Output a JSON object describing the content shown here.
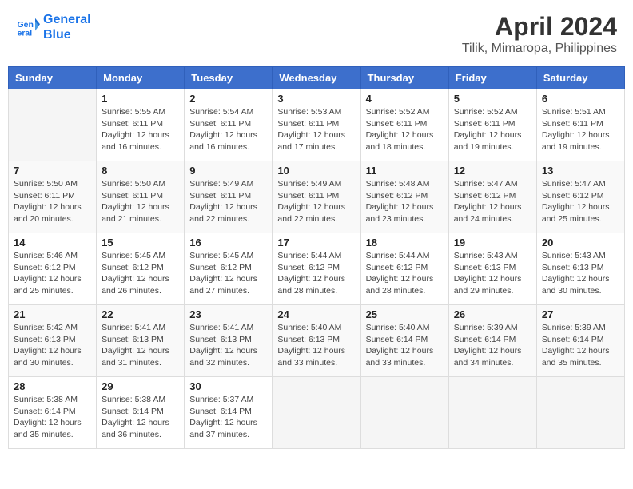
{
  "header": {
    "logo_line1": "General",
    "logo_line2": "Blue",
    "title": "April 2024",
    "subtitle": "Tilik, Mimaropa, Philippines"
  },
  "calendar": {
    "days_of_week": [
      "Sunday",
      "Monday",
      "Tuesday",
      "Wednesday",
      "Thursday",
      "Friday",
      "Saturday"
    ],
    "weeks": [
      [
        {
          "num": "",
          "info": ""
        },
        {
          "num": "1",
          "info": "Sunrise: 5:55 AM\nSunset: 6:11 PM\nDaylight: 12 hours\nand 16 minutes."
        },
        {
          "num": "2",
          "info": "Sunrise: 5:54 AM\nSunset: 6:11 PM\nDaylight: 12 hours\nand 16 minutes."
        },
        {
          "num": "3",
          "info": "Sunrise: 5:53 AM\nSunset: 6:11 PM\nDaylight: 12 hours\nand 17 minutes."
        },
        {
          "num": "4",
          "info": "Sunrise: 5:52 AM\nSunset: 6:11 PM\nDaylight: 12 hours\nand 18 minutes."
        },
        {
          "num": "5",
          "info": "Sunrise: 5:52 AM\nSunset: 6:11 PM\nDaylight: 12 hours\nand 19 minutes."
        },
        {
          "num": "6",
          "info": "Sunrise: 5:51 AM\nSunset: 6:11 PM\nDaylight: 12 hours\nand 19 minutes."
        }
      ],
      [
        {
          "num": "7",
          "info": "Sunrise: 5:50 AM\nSunset: 6:11 PM\nDaylight: 12 hours\nand 20 minutes."
        },
        {
          "num": "8",
          "info": "Sunrise: 5:50 AM\nSunset: 6:11 PM\nDaylight: 12 hours\nand 21 minutes."
        },
        {
          "num": "9",
          "info": "Sunrise: 5:49 AM\nSunset: 6:11 PM\nDaylight: 12 hours\nand 22 minutes."
        },
        {
          "num": "10",
          "info": "Sunrise: 5:49 AM\nSunset: 6:11 PM\nDaylight: 12 hours\nand 22 minutes."
        },
        {
          "num": "11",
          "info": "Sunrise: 5:48 AM\nSunset: 6:12 PM\nDaylight: 12 hours\nand 23 minutes."
        },
        {
          "num": "12",
          "info": "Sunrise: 5:47 AM\nSunset: 6:12 PM\nDaylight: 12 hours\nand 24 minutes."
        },
        {
          "num": "13",
          "info": "Sunrise: 5:47 AM\nSunset: 6:12 PM\nDaylight: 12 hours\nand 25 minutes."
        }
      ],
      [
        {
          "num": "14",
          "info": "Sunrise: 5:46 AM\nSunset: 6:12 PM\nDaylight: 12 hours\nand 25 minutes."
        },
        {
          "num": "15",
          "info": "Sunrise: 5:45 AM\nSunset: 6:12 PM\nDaylight: 12 hours\nand 26 minutes."
        },
        {
          "num": "16",
          "info": "Sunrise: 5:45 AM\nSunset: 6:12 PM\nDaylight: 12 hours\nand 27 minutes."
        },
        {
          "num": "17",
          "info": "Sunrise: 5:44 AM\nSunset: 6:12 PM\nDaylight: 12 hours\nand 28 minutes."
        },
        {
          "num": "18",
          "info": "Sunrise: 5:44 AM\nSunset: 6:12 PM\nDaylight: 12 hours\nand 28 minutes."
        },
        {
          "num": "19",
          "info": "Sunrise: 5:43 AM\nSunset: 6:13 PM\nDaylight: 12 hours\nand 29 minutes."
        },
        {
          "num": "20",
          "info": "Sunrise: 5:43 AM\nSunset: 6:13 PM\nDaylight: 12 hours\nand 30 minutes."
        }
      ],
      [
        {
          "num": "21",
          "info": "Sunrise: 5:42 AM\nSunset: 6:13 PM\nDaylight: 12 hours\nand 30 minutes."
        },
        {
          "num": "22",
          "info": "Sunrise: 5:41 AM\nSunset: 6:13 PM\nDaylight: 12 hours\nand 31 minutes."
        },
        {
          "num": "23",
          "info": "Sunrise: 5:41 AM\nSunset: 6:13 PM\nDaylight: 12 hours\nand 32 minutes."
        },
        {
          "num": "24",
          "info": "Sunrise: 5:40 AM\nSunset: 6:13 PM\nDaylight: 12 hours\nand 33 minutes."
        },
        {
          "num": "25",
          "info": "Sunrise: 5:40 AM\nSunset: 6:14 PM\nDaylight: 12 hours\nand 33 minutes."
        },
        {
          "num": "26",
          "info": "Sunrise: 5:39 AM\nSunset: 6:14 PM\nDaylight: 12 hours\nand 34 minutes."
        },
        {
          "num": "27",
          "info": "Sunrise: 5:39 AM\nSunset: 6:14 PM\nDaylight: 12 hours\nand 35 minutes."
        }
      ],
      [
        {
          "num": "28",
          "info": "Sunrise: 5:38 AM\nSunset: 6:14 PM\nDaylight: 12 hours\nand 35 minutes."
        },
        {
          "num": "29",
          "info": "Sunrise: 5:38 AM\nSunset: 6:14 PM\nDaylight: 12 hours\nand 36 minutes."
        },
        {
          "num": "30",
          "info": "Sunrise: 5:37 AM\nSunset: 6:14 PM\nDaylight: 12 hours\nand 37 minutes."
        },
        {
          "num": "",
          "info": ""
        },
        {
          "num": "",
          "info": ""
        },
        {
          "num": "",
          "info": ""
        },
        {
          "num": "",
          "info": ""
        }
      ]
    ]
  }
}
